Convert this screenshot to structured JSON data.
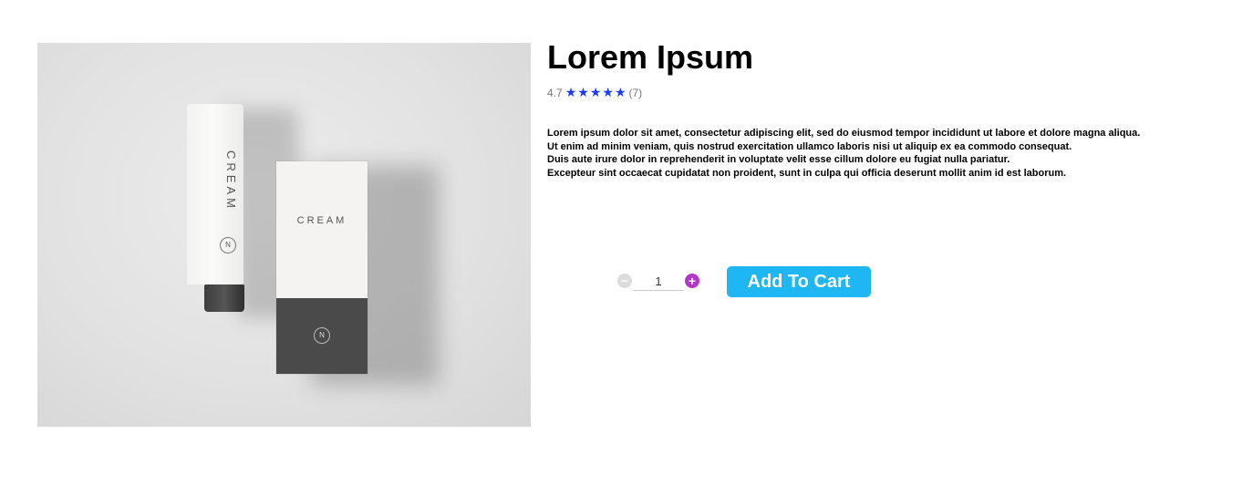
{
  "product": {
    "title": "Lorem Ipsum",
    "image": {
      "tube_label": "CREAM",
      "box_label": "CREAM",
      "logo_letter": "N"
    },
    "rating": {
      "value": "4.7",
      "stars": 5,
      "count_label": "(7)",
      "star_color": "#1a3bff"
    },
    "description": [
      "Lorem ipsum dolor sit amet, consectetur adipiscing elit, sed do eiusmod tempor incididunt ut labore et dolore magna aliqua.",
      "Ut enim ad minim veniam, quis nostrud exercitation ullamco laboris nisi ut aliquip ex ea commodo consequat.",
      "Duis aute irure dolor in reprehenderit in voluptate velit esse cillum dolore eu fugiat nulla pariatur.",
      "Excepteur sint occaecat cupidatat non proident, sunt in culpa qui officia deserunt mollit anim id est laborum."
    ]
  },
  "cart": {
    "quantity": "1",
    "minus_icon": "minus-circle-icon",
    "plus_icon": "plus-circle-icon",
    "add_label": "Add To Cart",
    "button_color": "#1fb6f4"
  }
}
